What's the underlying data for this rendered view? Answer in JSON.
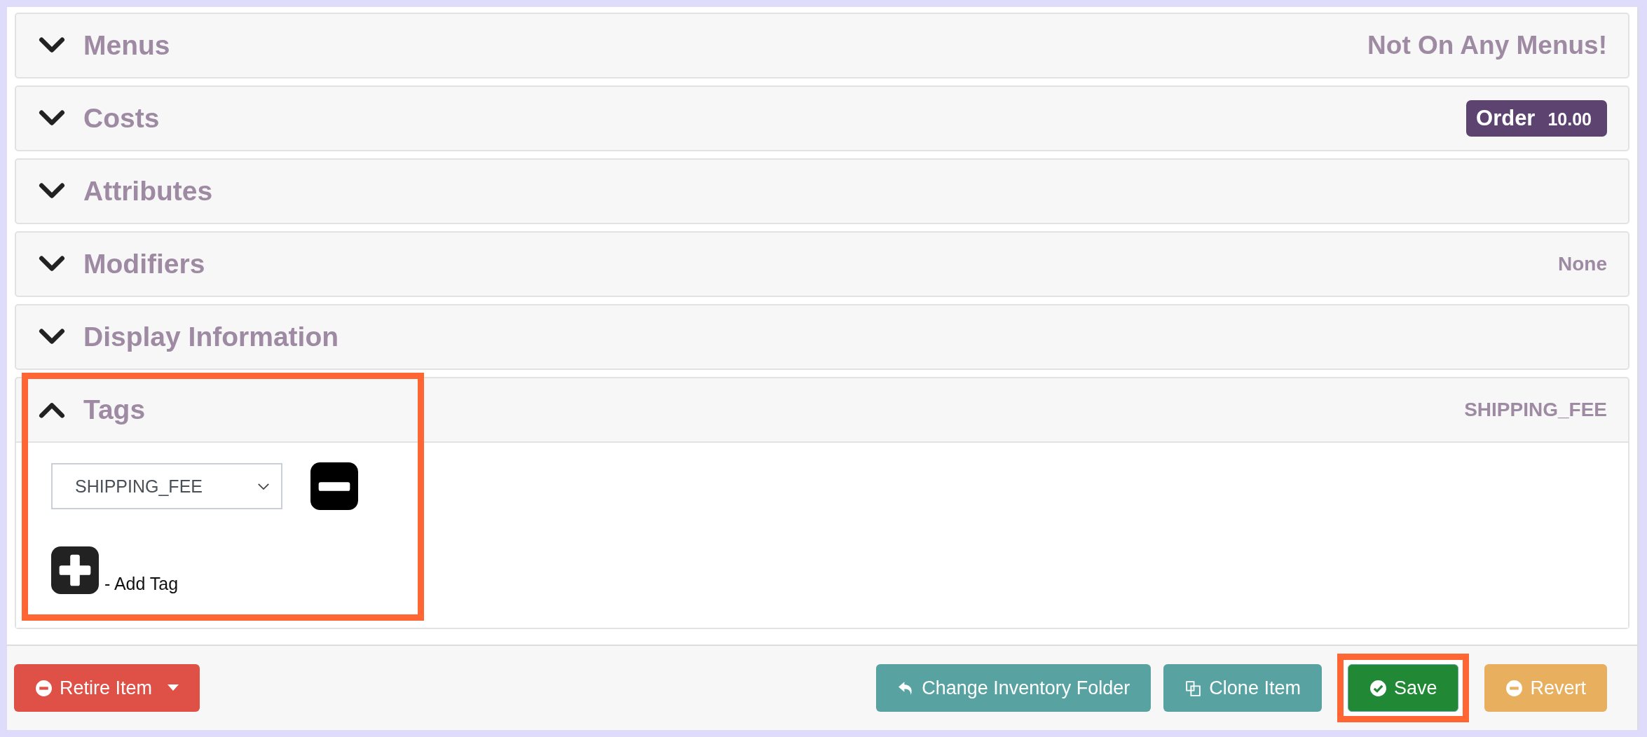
{
  "panels": [
    {
      "title": "Menus",
      "expanded": false,
      "highlighted": false,
      "summary": {
        "kind": "large",
        "text": "Not On Any Menus!"
      }
    },
    {
      "title": "Costs",
      "expanded": false,
      "highlighted": false,
      "summary": {
        "kind": "badge",
        "label": "Order",
        "value": "10.00"
      }
    },
    {
      "title": "Attributes",
      "expanded": false,
      "highlighted": false
    },
    {
      "title": "Modifiers",
      "expanded": false,
      "highlighted": false,
      "summary": {
        "kind": "small",
        "text": "None"
      }
    },
    {
      "title": "Display Information",
      "expanded": false,
      "highlighted": false
    },
    {
      "title": "Tags",
      "expanded": true,
      "highlighted": true,
      "summary": {
        "kind": "small",
        "text": "SHIPPING_FEE"
      },
      "tags": [
        {
          "value": "SHIPPING_FEE"
        }
      ],
      "add_label": "- Add Tag"
    }
  ],
  "footer": {
    "left": [
      {
        "label": "Retire Item",
        "kind": "retire",
        "highlighted": false
      }
    ],
    "right": [
      {
        "label": "Change Inventory Folder",
        "kind": "move",
        "highlighted": false
      },
      {
        "label": "Clone Item",
        "kind": "clone",
        "highlighted": false
      },
      {
        "label": "Save",
        "kind": "save",
        "highlighted": true
      },
      {
        "label": "Revert",
        "kind": "revert",
        "highlighted": false
      }
    ]
  }
}
